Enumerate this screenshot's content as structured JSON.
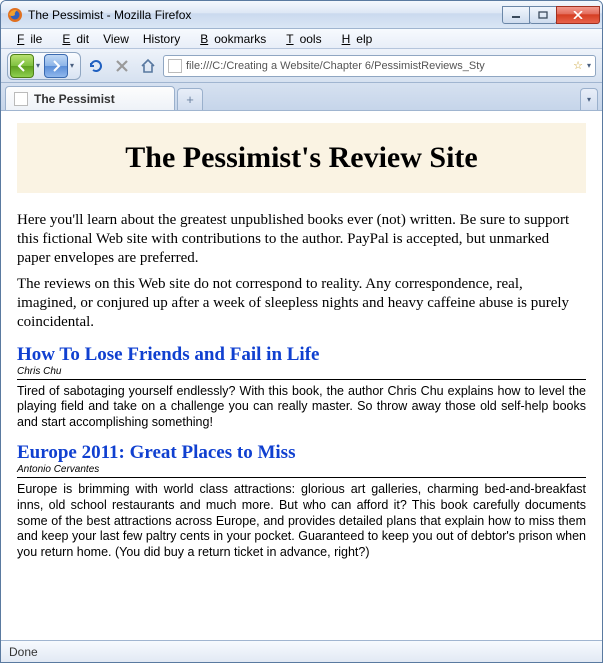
{
  "window": {
    "title": "The Pessimist - Mozilla Firefox"
  },
  "menubar": {
    "file": "File",
    "edit": "Edit",
    "view": "View",
    "history": "History",
    "bookmarks": "Bookmarks",
    "tools": "Tools",
    "help": "Help"
  },
  "toolbar": {
    "url": "file:///C:/Creating a Website/Chapter 6/PessimistReviews_Sty"
  },
  "tabs": {
    "active": "The Pessimist",
    "newtab": "+"
  },
  "page": {
    "banner_title": "The Pessimist's Review Site",
    "intro1": "Here you'll learn about the greatest unpublished books ever (not) written. Be sure to support this fictional Web site with contributions to the author. PayPal is accepted, but unmarked paper envelopes are preferred.",
    "intro2": "The reviews on this Web site do not correspond to reality. Any correspondence, real, imagined, or conjured up after a week of sleepless nights and heavy caffeine abuse is purely coincidental.",
    "reviews": [
      {
        "title": "How To Lose Friends and Fail in Life",
        "author": "Chris Chu",
        "body": "Tired of sabotaging yourself endlessly? With this book, the author Chris Chu explains how to level the playing field and take on a challenge you can really master. So throw away those old self-help books and start accomplishing something!"
      },
      {
        "title": "Europe 2011: Great Places to Miss",
        "author": "Antonio Cervantes",
        "body": "Europe is brimming with world class attractions: glorious art galleries, charming bed-and-breakfast inns, old school restaurants and much more. But who can afford it? This book carefully documents some of the best attractions across Europe, and provides detailed plans that explain how to miss them and keep your last few paltry cents in your pocket. Guaranteed to keep you out of debtor's prison when you return home. (You did buy a return ticket in advance, right?)"
      }
    ]
  },
  "statusbar": {
    "text": "Done"
  }
}
